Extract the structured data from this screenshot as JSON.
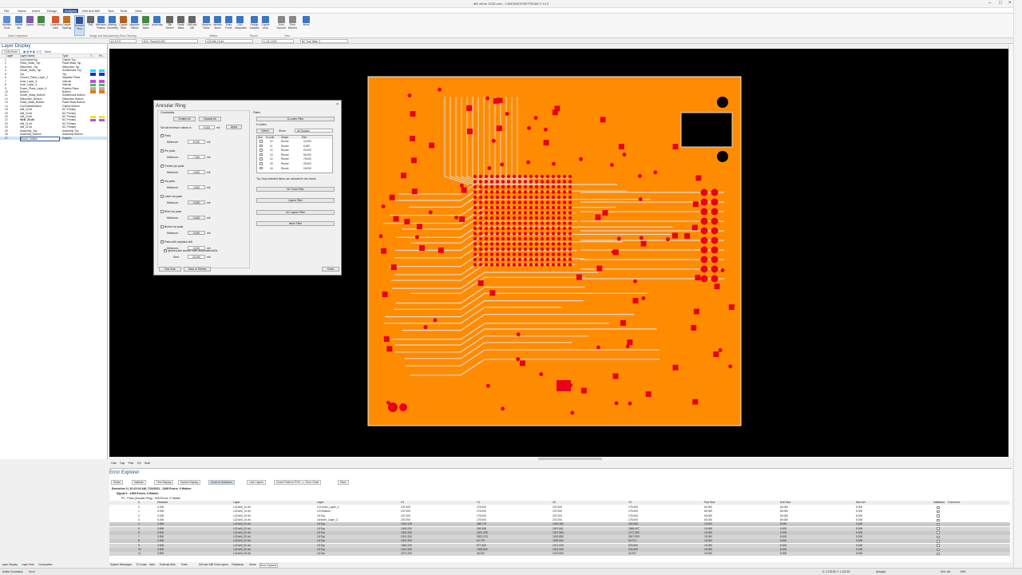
{
  "app": {
    "title": "drill demo 2025.cam - CAM350/DFMSTREAM V 14.5"
  },
  "menu": [
    "File",
    "Home",
    "Insert",
    "Design",
    "Analysis",
    "Drill and Mill",
    "Tool",
    "Tools",
    "View"
  ],
  "menu_active": "Analysis",
  "ribbon": {
    "buttons": [
      {
        "label": "NetMint Tools",
        "icon": "netlist-icon",
        "color": "#5b8bd6"
      },
      {
        "label": "Netlist Info",
        "icon": "netlist-info-icon",
        "color": "#4a7fc6"
      },
      {
        "label": "Layers",
        "icon": "layers-icon",
        "color": "#7b5ea8"
      },
      {
        "label": "Design",
        "icon": "design-icon",
        "color": "#3f8a3f"
      },
      {
        "label": "Clearance Data",
        "icon": "clearance-icon",
        "color": "#d85a2a"
      },
      {
        "label": "Copper Spacing",
        "icon": "copper-icon",
        "color": "#c07020"
      },
      {
        "label": "Annular Ring",
        "icon": "annular-ring-icon",
        "color": "#2b579a"
      },
      {
        "label": "Drill",
        "icon": "drill-icon",
        "color": "#666"
      },
      {
        "label": "Minimum Feature",
        "icon": "min-feature-icon",
        "color": "#3a76c4"
      },
      {
        "label": "Missing Geometry",
        "icon": "geometry-icon",
        "color": "#3a76c4"
      },
      {
        "label": "Copper Sliver",
        "icon": "sliver-icon",
        "color": "#b45e1c"
      },
      {
        "label": "Negative Planes",
        "icon": "planes-icon",
        "color": "#3a76c4"
      },
      {
        "label": "Solder Mask",
        "icon": "mask-icon",
        "color": "#3f8a3f"
      },
      {
        "label": "Assembly",
        "icon": "assembly-icon",
        "color": "#3a76c4"
      },
      {
        "label": "Silk Screen",
        "icon": "silk-icon",
        "color": "#666"
      },
      {
        "label": "Paste Mask",
        "icon": "paste-icon",
        "color": "#666"
      },
      {
        "label": "Drill and Mill",
        "icon": "drill-mill-icon",
        "color": "#666"
      },
      {
        "label": "Streams Editor",
        "icon": "streams-icon",
        "color": "#3a76c4"
      },
      {
        "label": "Intrinsic Items",
        "icon": "intrinsic-icon",
        "color": "#3a76c4"
      },
      {
        "label": "Entry Probe",
        "icon": "probe-icon",
        "color": "#3a76c4"
      },
      {
        "label": "CAD Integration",
        "icon": "cad-icon",
        "color": "#3a76c4"
      },
      {
        "label": "Design Analysis",
        "icon": "analysis-icon",
        "color": "#3a76c4"
      },
      {
        "label": "Copper Area",
        "icon": "area-icon",
        "color": "#3a76c4"
      },
      {
        "label": "Error Explorer",
        "icon": "error-explorer-icon",
        "color": "#888"
      },
      {
        "label": "Error Markers",
        "icon": "error-markers-icon",
        "color": "#888"
      },
      {
        "label": "Items",
        "icon": "items-icon",
        "color": "#3a76c4"
      }
    ],
    "groups": [
      "Data Comparison",
      "Design and Manufacturing Rule Checking",
      "Utilities",
      "Report",
      "View"
    ]
  },
  "toolbar2": {
    "grid": "(1) 1/2.0",
    "dcode": "D11 : Round 6.000",
    "layer": "L22:drill_10.drl",
    "zoom": "1 | 11.0.000",
    "tool_table": "NC Tool Table: 2"
  },
  "layer_panel": {
    "title": "Layer Display",
    "mode": "CAM Mode",
    "more": "More...",
    "columns": [
      "Layer",
      "Layer Name",
      "Type",
      "T...",
      "Fe..."
    ],
    "rows": [
      {
        "num": "1",
        "name": "ConOutlineTop",
        "type": "Outline Top",
        "color": ""
      },
      {
        "num": "2",
        "name": "Paste_Mask_Top",
        "type": "Paste Mask Top",
        "color": ""
      },
      {
        "num": "3",
        "name": "Silkscreen_Top",
        "type": "Silkscreen Top",
        "color": ""
      },
      {
        "num": "4",
        "name": "Solder_Mask_Top",
        "type": "Soldermask Top",
        "color": "#00e5ff"
      },
      {
        "num": "5",
        "name": "Top",
        "type": "Top",
        "color": "#1a2fd6"
      },
      {
        "num": "6",
        "name": "Ground_Plane_Layer_2",
        "type": "Negative Plane",
        "color": ""
      },
      {
        "num": "7",
        "name": "Inner_Layer_3",
        "type": "Internal",
        "color": "#c04fd6"
      },
      {
        "num": "8",
        "name": "Inner_Layer_4",
        "type": "Internal",
        "color": "#42c442"
      },
      {
        "num": "9",
        "name": "Power_Plane_Layer_5",
        "type": "Positive Plane",
        "color": "#b0b0b0"
      },
      {
        "num": "10",
        "name": "Bottom",
        "type": "Bottom",
        "color": "#e07a2a"
      },
      {
        "num": "11",
        "name": "Solder_Mask_Bottom",
        "type": "Soldermask Bottom",
        "color": ""
      },
      {
        "num": "12",
        "name": "Silkscreen_Bottom",
        "type": "Silkscreen Bottom",
        "color": ""
      },
      {
        "num": "13",
        "name": "Paste_Mask_Bottom",
        "type": "Paste Mask Bottom",
        "color": ""
      },
      {
        "num": "14",
        "name": "ConOutlineBottom",
        "type": "Outline Bottom",
        "color": ""
      },
      {
        "num": "15",
        "name": "drill_10.drl",
        "type": "NC Primary",
        "color": ""
      },
      {
        "num": "19",
        "name": "drill_10.drl",
        "type": "NC Primary",
        "color": ""
      },
      {
        "num": "20",
        "name": "drill_10.drl",
        "type": "NC Primary",
        "color": "#e8e82a"
      },
      {
        "num": "22",
        "name": "*drill_20.drl",
        "type": "NC Primary",
        "color": "#c04fd6"
      },
      {
        "num": "23",
        "name": "drill_21.drl",
        "type": "NC Primary",
        "color": ""
      },
      {
        "num": "24",
        "name": "drill_22.drl",
        "type": "NC Primary",
        "color": ""
      },
      {
        "num": "25",
        "name": "Assembly_Top",
        "type": "Assembly Top",
        "color": ""
      },
      {
        "num": "26",
        "name": "Assembly_Bottom",
        "type": "Assembly Bottom",
        "color": ""
      },
      {
        "num": "27",
        "name": "Board_Outline",
        "type": "Graphic",
        "color": ""
      }
    ]
  },
  "dialog": {
    "title": "Annular Ring",
    "constraints_label": "Constraints",
    "enable_all": "Enable All",
    "disable_all": "Disable All",
    "set_all_label": "Set all minimum values to",
    "set_all_value": "6.000",
    "unit": "mil",
    "apply": "Apply",
    "checks": [
      {
        "label": "Pads",
        "min": "6.000"
      },
      {
        "label": "Pin pads",
        "min": "7.000"
      },
      {
        "label": "Feeder pin pads",
        "min": "4.000"
      },
      {
        "label": "Via pads",
        "min": "4.000"
      },
      {
        "label": "Laser via pads",
        "min": "0.000"
      },
      {
        "label": "Blind via pads",
        "min": "0.000"
      },
      {
        "label": "Buried via pads",
        "min": "0.000"
      },
      {
        "label": "Pads with unplated drill",
        "min": "5.000"
      }
    ],
    "minimum_label": "Minimum:",
    "ignore_label": "Ignore pads smaller than associated drills",
    "size_label": "Size:",
    "size_value": "20.000",
    "filters_label": "Filters",
    "dcodes_filter": "D-codes Filter",
    "dcodes_label": "D-codes",
    "select_label": "Select",
    "show_label": "Show:",
    "show_value": "All Dcodes",
    "dcode_cols": [
      "Use",
      "D-code",
      "Shape",
      "Size"
    ],
    "dcode_rows": [
      {
        "d": "10",
        "shape": "Round",
        "size": "10.000"
      },
      {
        "d": "11",
        "shape": "Round",
        "size": "6.000"
      },
      {
        "d": "12",
        "shape": "Round",
        "size": "20.000"
      },
      {
        "d": "13",
        "shape": "Round",
        "size": "50.000"
      },
      {
        "d": "14",
        "shape": "Round",
        "size": "75.000"
      },
      {
        "d": "15",
        "shape": "Round",
        "size": "25.000"
      },
      {
        "d": "16",
        "shape": "Round",
        "size": "15.000"
      }
    ],
    "tip": "Tip: Only selected items are included in the check.",
    "nc_tools_filter": "NC Tools Filter",
    "layers_filter": "Layers Filter",
    "nc_layers_filter": "NC Layers Filter",
    "items_filter": "Items Filter",
    "run_now": "Run Now",
    "save_stream": "Save to Stream",
    "close": "Close"
  },
  "canvas_tabs": [
    "Cam",
    "Cap",
    "Part",
    "DX",
    "Start"
  ],
  "error_explorer": {
    "title": "Error Explorer",
    "tools": [
      "Select",
      "Validate",
      "Tree Display",
      "Hydros Display",
      "Zoom to Selection",
      "Lock Layers",
      "Cross Probe to PCB",
      "Error Chart",
      "Save"
    ],
    "tree": [
      "Execution 0 | 10:22:34 AM, 7/23/2021 - 1266 Errors, 0 Hidden",
      "Signal 0 - 1266 Errors, 0 Hidden",
      "P2 - Pads (Annular Ring) - 628 Errors, 0 Hidden"
    ],
    "columns": [
      "#",
      "Distance",
      "Layer",
      "Layer",
      "X1",
      "Y1",
      "X2",
      "Y2",
      "Pad Size",
      "Drill Size",
      "Min Def",
      "Validated",
      "Comment"
    ],
    "rows": [
      [
        "0",
        "0.000",
        "L22:drill_10.drl",
        "L11:Inner_Layer_4",
        "237.000",
        "175.000",
        "237.000",
        "175.000",
        "60.000",
        "60.000",
        "5.000"
      ],
      [
        "1",
        "0.000",
        "L22:drill_10.drl",
        "L10:Bottom",
        "237.000",
        "175.000",
        "237.000",
        "175.000",
        "60.000",
        "60.000",
        "5.000"
      ],
      [
        "2",
        "0.000",
        "L22:drill_10.drl",
        "L5:Top",
        "237.000",
        "175.000",
        "237.000",
        "175.000",
        "60.000",
        "60.000",
        "5.000"
      ],
      [
        "3",
        "0.000",
        "L22:drill_10.drl",
        "L8:Inner_Layer_3",
        "237.000",
        "175.000",
        "237.000",
        "175.000",
        "60.000",
        "60.000",
        "5.000"
      ],
      [
        "4",
        "3.500",
        "L22:drill_20.drl",
        "L5:Top",
        "1001.318",
        "288.779",
        "1002.463",
        "292.083",
        "15.000",
        "8.000",
        "5.000"
      ],
      [
        "5",
        "3.500",
        "L22:drill_20.drl",
        "L5:Top",
        "1000.200",
        "351.538",
        "1007.541",
        "2569.407",
        "15.000",
        "8.000",
        "5.000"
      ],
      [
        "6",
        "3.500",
        "L22:drill_20.drl",
        "L5:Top",
        "1000.333",
        "1181.228",
        "1007.565",
        "1177.929",
        "15.000",
        "8.000",
        "5.000"
      ],
      [
        "7",
        "3.500",
        "L22:drill_20.drl",
        "L5:Top",
        "1001.333",
        "2521.223",
        "1002.850",
        "2517.929",
        "15.000",
        "8.000",
        "5.000"
      ],
      [
        "8",
        "3.500",
        "L22:drill_20.drl",
        "L5:Top",
        "1001.333",
        "92.779",
        "1092.500",
        "92.071",
        "15.000",
        "8.000",
        "5.000"
      ],
      [
        "9",
        "3.500",
        "L22:drill_20.drl",
        "L5:Top",
        "1060.200",
        "877.400",
        "1071.000",
        "876.600",
        "15.000",
        "8.000",
        "5.000"
      ],
      [
        "10",
        "3.500",
        "L22:drill_20.drl",
        "L5:Top",
        "1001.333",
        "1390.800",
        "1001.500",
        "119.600",
        "15.000",
        "8.000",
        "5.000"
      ],
      [
        "11",
        "3.500",
        "L22:drill_20.drl",
        "L5:Top",
        "1271.333",
        "46.222",
        "1272.500",
        "42.917",
        "15.000",
        "8.000",
        "5.000"
      ]
    ]
  },
  "bottom_tabs": [
    "System Messages",
    "D-Codes",
    "Nets",
    "External Nets",
    "Parts",
    "Drill and Mill Tools",
    "Layers",
    "Padstacks",
    "Areas",
    "Error Explorer"
  ],
  "left_tabs": [
    "Layer Display",
    "Layer Sets",
    "Composites"
  ],
  "status": {
    "command_label": "Active Command:",
    "command_value": "None",
    "coords": "X: 2,133.50  Y: 1,132.60",
    "units": "Unit: mil",
    "zoom": "69%",
    "autopan": "Autopan"
  },
  "colors": {
    "board": "#ff8c00",
    "pad": "#e8001c",
    "trace": "#d9d9d9",
    "canvas": "#000000",
    "accent": "#2b579a"
  }
}
